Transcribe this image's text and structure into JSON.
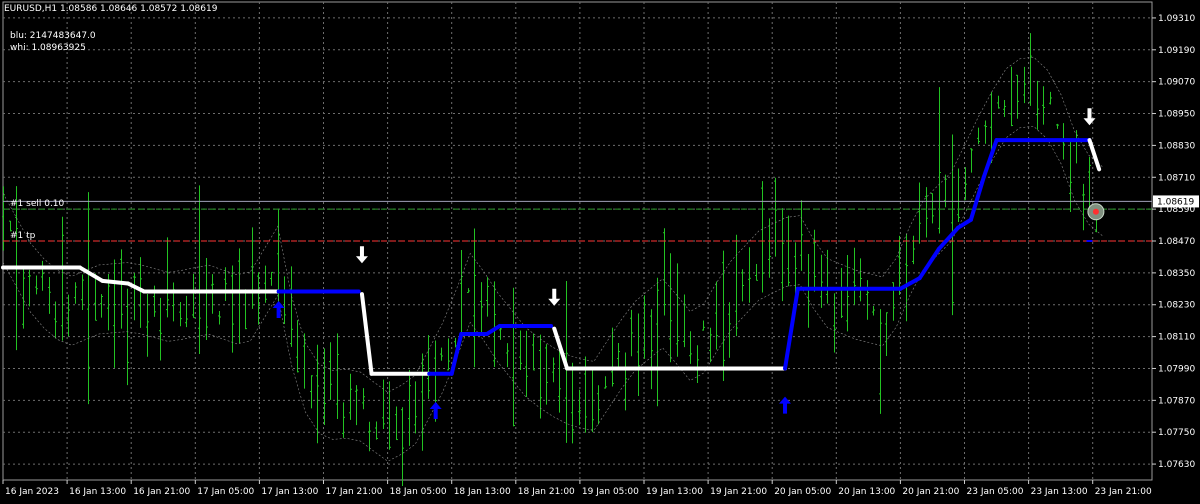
{
  "header": {
    "symbol_line": "EURUSD,H1  1.08586 1.08646 1.08572 1.08619",
    "line2": "blu: 2147483647.0",
    "line3": "whi: 1.08963925"
  },
  "order_labels": {
    "sell": "#1 sell 0.10",
    "tp": "#1 tp"
  },
  "price_axis": {
    "labels": [
      "1.09310",
      "1.09190",
      "1.09070",
      "1.08950",
      "1.08830",
      "1.08710",
      "1.08590",
      "1.08470",
      "1.08350",
      "1.08230",
      "1.08110",
      "1.07990",
      "1.07870",
      "1.07750",
      "1.07630"
    ],
    "current_price": "1.08619"
  },
  "time_axis": {
    "labels": [
      "16 Jan 2023",
      "16 Jan 13:00",
      "16 Jan 21:00",
      "17 Jan 05:00",
      "17 Jan 13:00",
      "17 Jan 21:00",
      "18 Jan 05:00",
      "18 Jan 13:00",
      "18 Jan 21:00",
      "19 Jan 05:00",
      "19 Jan 13:00",
      "19 Jan 21:00",
      "20 Jan 05:00",
      "20 Jan 13:00",
      "20 Jan 21:00",
      "23 Jan 05:00",
      "23 Jan 13:00",
      "23 Jan 21:00"
    ]
  },
  "colors": {
    "background": "#000000",
    "grid": "#6e6e6e",
    "candles": "#22c322",
    "trend_up": "#0000ff",
    "trend_down": "#ffffff",
    "sell_line": "#2a9a2a",
    "tp_line": "#ff3333",
    "price_line": "#a0a0b8"
  },
  "chart_data": {
    "type": "line",
    "symbol": "EURUSD",
    "timeframe": "H1",
    "ylim": [
      1.0757,
      1.0937
    ],
    "grid": true,
    "x": [
      "16 Jan 2023",
      "16 Jan 13:00",
      "16 Jan 21:00",
      "17 Jan 05:00",
      "17 Jan 13:00",
      "17 Jan 21:00",
      "18 Jan 05:00",
      "18 Jan 13:00",
      "18 Jan 21:00",
      "19 Jan 05:00",
      "19 Jan 13:00",
      "19 Jan 21:00",
      "20 Jan 05:00",
      "20 Jan 13:00",
      "20 Jan 21:00",
      "23 Jan 05:00",
      "23 Jan 13:00",
      "23 Jan 21:00"
    ],
    "levels": {
      "current_price": 1.08619,
      "sell_entry": 1.0859,
      "take_profit": 1.0847
    },
    "trend_line": [
      {
        "t": 0,
        "p": 1.0837,
        "c": "white"
      },
      {
        "t": 1.2,
        "p": 1.0837,
        "c": "white"
      },
      {
        "t": 1.55,
        "p": 1.0832,
        "c": "white"
      },
      {
        "t": 1.95,
        "p": 1.0831,
        "c": "white"
      },
      {
        "t": 2.2,
        "p": 1.0828,
        "c": "white"
      },
      {
        "t": 4.3,
        "p": 1.0828,
        "c": "white"
      },
      {
        "t": 4.3,
        "p": 1.0828,
        "c": "blue"
      },
      {
        "t": 5.55,
        "p": 1.0828,
        "c": "blue"
      },
      {
        "t": 5.6,
        "p": 1.0827,
        "c": "white"
      },
      {
        "t": 5.75,
        "p": 1.0797,
        "c": "white"
      },
      {
        "t": 6.65,
        "p": 1.0797,
        "c": "white"
      },
      {
        "t": 6.65,
        "p": 1.0797,
        "c": "blue"
      },
      {
        "t": 7.0,
        "p": 1.0797,
        "c": "blue"
      },
      {
        "t": 7.15,
        "p": 1.0812,
        "c": "blue"
      },
      {
        "t": 7.55,
        "p": 1.0812,
        "c": "blue"
      },
      {
        "t": 7.75,
        "p": 1.0815,
        "c": "blue"
      },
      {
        "t": 8.55,
        "p": 1.0815,
        "c": "blue"
      },
      {
        "t": 8.6,
        "p": 1.0814,
        "c": "white"
      },
      {
        "t": 8.8,
        "p": 1.0799,
        "c": "white"
      },
      {
        "t": 12.2,
        "p": 1.0799,
        "c": "white"
      },
      {
        "t": 12.2,
        "p": 1.0799,
        "c": "blue"
      },
      {
        "t": 12.4,
        "p": 1.0829,
        "c": "blue"
      },
      {
        "t": 14.0,
        "p": 1.0829,
        "c": "blue"
      },
      {
        "t": 14.3,
        "p": 1.0833,
        "c": "blue"
      },
      {
        "t": 14.6,
        "p": 1.0844,
        "c": "blue"
      },
      {
        "t": 14.9,
        "p": 1.0852,
        "c": "blue"
      },
      {
        "t": 15.1,
        "p": 1.0855,
        "c": "blue"
      },
      {
        "t": 15.3,
        "p": 1.0871,
        "c": "blue"
      },
      {
        "t": 15.5,
        "p": 1.0885,
        "c": "blue"
      },
      {
        "t": 16.95,
        "p": 1.0885,
        "c": "blue"
      },
      {
        "t": 16.95,
        "p": 1.0885,
        "c": "white"
      },
      {
        "t": 17.1,
        "p": 1.0874,
        "c": "white"
      }
    ],
    "signals": [
      {
        "t": 4.3,
        "p": 1.0821,
        "dir": "up"
      },
      {
        "t": 5.6,
        "p": 1.0842,
        "dir": "down"
      },
      {
        "t": 6.75,
        "p": 1.0783,
        "dir": "up"
      },
      {
        "t": 8.6,
        "p": 1.0826,
        "dir": "down"
      },
      {
        "t": 12.2,
        "p": 1.0785,
        "dir": "up"
      },
      {
        "t": 16.95,
        "p": 1.0894,
        "dir": "down"
      }
    ]
  }
}
